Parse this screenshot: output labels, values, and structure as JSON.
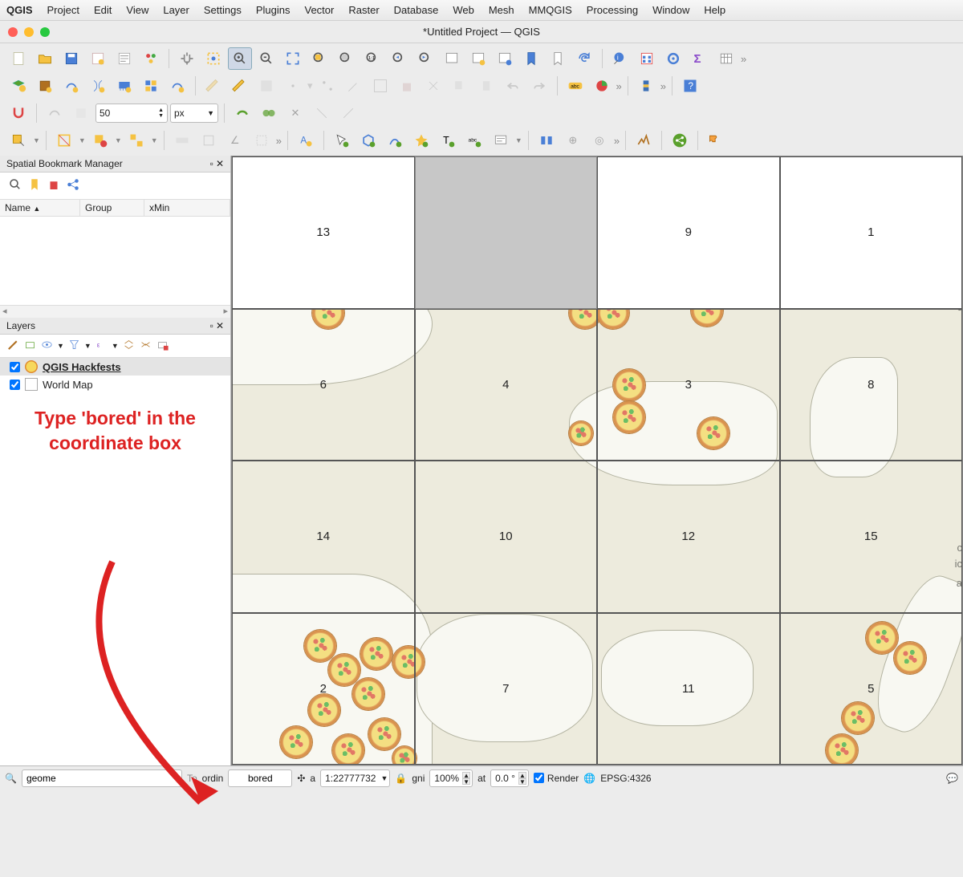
{
  "app_name": "QGIS",
  "menu": [
    "Project",
    "Edit",
    "View",
    "Layer",
    "Settings",
    "Plugins",
    "Vector",
    "Raster",
    "Database",
    "Web",
    "Mesh",
    "MMQGIS",
    "Processing",
    "Window",
    "Help"
  ],
  "window_title": "*Untitled Project — QGIS",
  "toolbar3": {
    "snap_value": "50",
    "snap_unit": "px"
  },
  "bookmark_panel": {
    "title": "Spatial Bookmark Manager",
    "columns": [
      "Name",
      "Group",
      "xMin"
    ]
  },
  "layers_panel": {
    "title": "Layers",
    "items": [
      {
        "checked": true,
        "name": "QGIS Hackfests",
        "icon": "pizza",
        "selected": true
      },
      {
        "checked": true,
        "name": "World Map",
        "icon": "blank",
        "selected": false
      }
    ]
  },
  "callout_text": "Type 'bored' in the coordinate box",
  "puzzle_tiles": [
    {
      "row": 0,
      "col": 0,
      "label": "13",
      "style": "blank"
    },
    {
      "row": 0,
      "col": 1,
      "label": "",
      "style": "gray"
    },
    {
      "row": 0,
      "col": 2,
      "label": "9",
      "style": "blank"
    },
    {
      "row": 0,
      "col": 3,
      "label": "1",
      "style": "blank"
    },
    {
      "row": 1,
      "col": 0,
      "label": "6"
    },
    {
      "row": 1,
      "col": 1,
      "label": "4"
    },
    {
      "row": 1,
      "col": 2,
      "label": "3"
    },
    {
      "row": 1,
      "col": 3,
      "label": "8"
    },
    {
      "row": 2,
      "col": 0,
      "label": "14"
    },
    {
      "row": 2,
      "col": 1,
      "label": "10"
    },
    {
      "row": 2,
      "col": 2,
      "label": "12"
    },
    {
      "row": 2,
      "col": 3,
      "label": "15"
    },
    {
      "row": 3,
      "col": 0,
      "label": "2"
    },
    {
      "row": 3,
      "col": 1,
      "label": "7"
    },
    {
      "row": 3,
      "col": 2,
      "label": "11"
    },
    {
      "row": 3,
      "col": 3,
      "label": "5"
    }
  ],
  "edge_letters": [
    "c",
    "c",
    "c",
    "ic",
    "a"
  ],
  "statusbar": {
    "search_icon": "🔍",
    "search_value": "geome",
    "toggle_label": "To",
    "coord_label": "ordin",
    "coord_value": "bored",
    "scale_prefix": "a",
    "scale_value": "1:22777732",
    "lock_icon": "🔒",
    "magnifier_label": "gni",
    "magnifier_value": "100%",
    "rotation_label": "at",
    "rotation_value": "0.0 °",
    "render_label": "Render",
    "crs_label": "EPSG:4326",
    "crs_icon": "🌐"
  }
}
